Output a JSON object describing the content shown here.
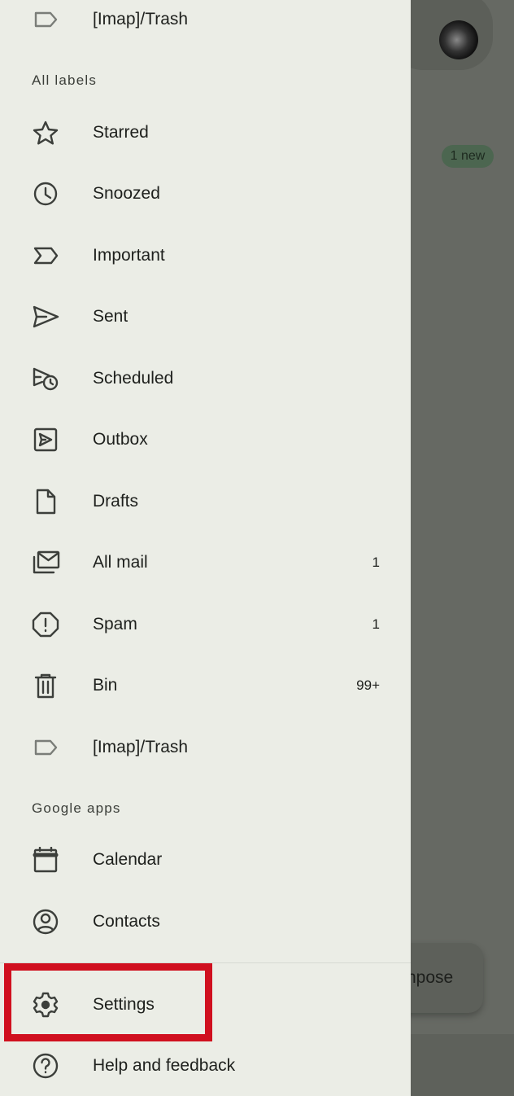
{
  "background": {
    "badge": "1 new",
    "compose_label": "npose"
  },
  "drawer": {
    "top_item": {
      "label": "[Imap]/Trash",
      "icon": "label-icon"
    },
    "all_labels_header": "All labels",
    "labels": [
      {
        "label": "Starred",
        "icon": "star-icon",
        "count": ""
      },
      {
        "label": "Snoozed",
        "icon": "clock-icon",
        "count": ""
      },
      {
        "label": "Important",
        "icon": "important-icon",
        "count": ""
      },
      {
        "label": "Sent",
        "icon": "send-icon",
        "count": ""
      },
      {
        "label": "Scheduled",
        "icon": "scheduled-icon",
        "count": ""
      },
      {
        "label": "Outbox",
        "icon": "outbox-icon",
        "count": ""
      },
      {
        "label": "Drafts",
        "icon": "draft-icon",
        "count": ""
      },
      {
        "label": "All mail",
        "icon": "all-mail-icon",
        "count": "1"
      },
      {
        "label": "Spam",
        "icon": "spam-icon",
        "count": "1"
      },
      {
        "label": "Bin",
        "icon": "trash-icon",
        "count": "99+"
      },
      {
        "label": "[Imap]/Trash",
        "icon": "label-icon",
        "count": ""
      }
    ],
    "google_apps_header": "Google apps",
    "apps": [
      {
        "label": "Calendar",
        "icon": "calendar-icon"
      },
      {
        "label": "Contacts",
        "icon": "contacts-icon"
      }
    ],
    "settings": {
      "label": "Settings",
      "icon": "gear-icon"
    },
    "help": {
      "label": "Help and feedback",
      "icon": "help-icon"
    }
  },
  "colors": {
    "highlight": "#d0101f",
    "drawer_bg": "#ebede6",
    "scrim": "#666963"
  }
}
